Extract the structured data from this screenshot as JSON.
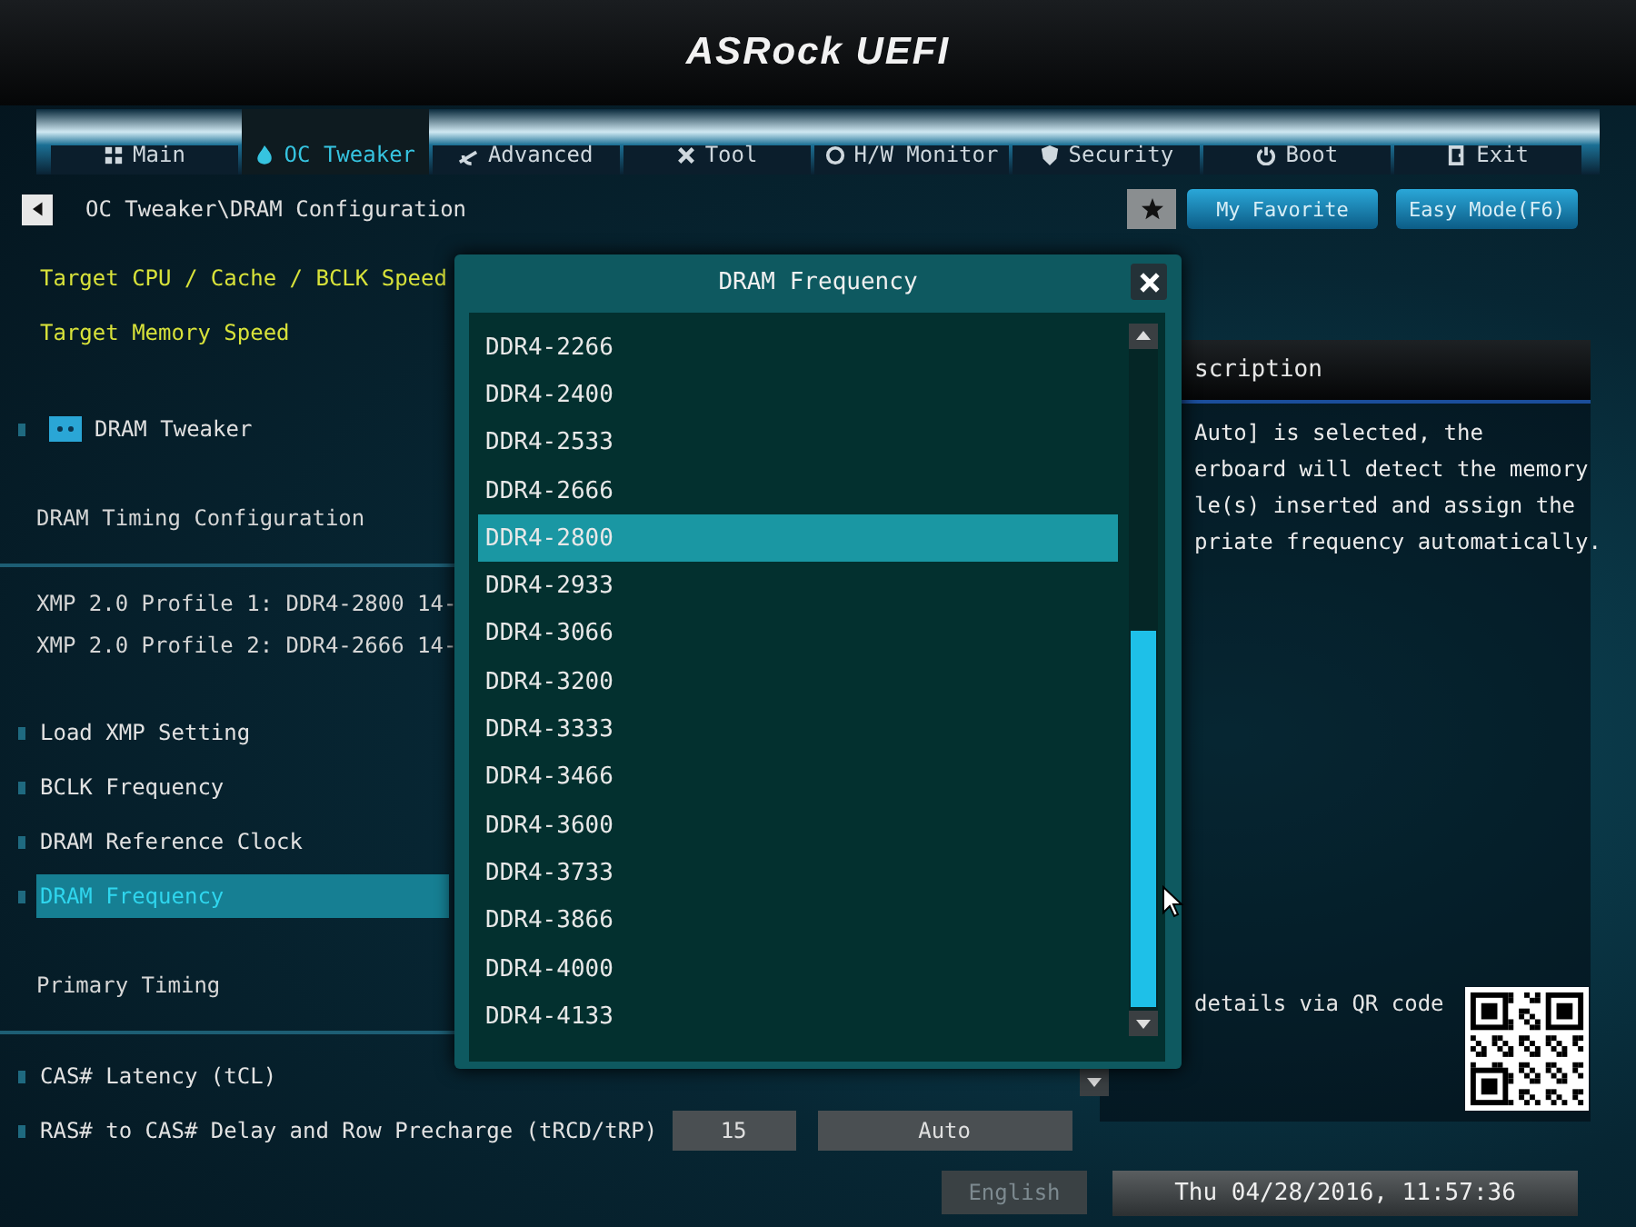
{
  "header": {
    "logo": "ASRock UEFI"
  },
  "tabs": [
    {
      "label": "Main",
      "selected": false
    },
    {
      "label": "OC Tweaker",
      "selected": true
    },
    {
      "label": "Advanced",
      "selected": false
    },
    {
      "label": "Tool",
      "selected": false
    },
    {
      "label": "H/W Monitor",
      "selected": false
    },
    {
      "label": "Security",
      "selected": false
    },
    {
      "label": "Boot",
      "selected": false
    },
    {
      "label": "Exit",
      "selected": false
    }
  ],
  "breadcrumb": {
    "path": "OC Tweaker\\DRAM Configuration"
  },
  "toolbar_buttons": [
    "My Favorite",
    "Easy Mode(F6)"
  ],
  "settings": [
    {
      "kind": "target",
      "label": "Target CPU / Cache / BCLK Speed"
    },
    {
      "kind": "target",
      "label": "Target Memory Speed"
    },
    {
      "kind": "submenu",
      "label": "DRAM Tweaker"
    },
    {
      "kind": "section",
      "label": "DRAM Timing Configuration"
    },
    {
      "kind": "profile",
      "label": "XMP 2.0 Profile 1: DDR4-2800 14-"
    },
    {
      "kind": "profile",
      "label": "XMP 2.0 Profile 2: DDR4-2666 14-"
    },
    {
      "kind": "item",
      "label": "Load XMP Setting",
      "selected": false
    },
    {
      "kind": "item",
      "label": "BCLK Frequency",
      "selected": false
    },
    {
      "kind": "item",
      "label": "DRAM Reference Clock",
      "selected": false
    },
    {
      "kind": "item",
      "label": "DRAM Frequency",
      "selected": true
    },
    {
      "kind": "section",
      "label": "Primary Timing"
    },
    {
      "kind": "item",
      "label": "CAS# Latency (tCL)",
      "selected": false
    },
    {
      "kind": "item",
      "label": "RAS# to CAS# Delay and Row Precharge (tRCD/tRP)",
      "selected": false,
      "values": [
        "15",
        "Auto"
      ]
    }
  ],
  "description": {
    "title": "scription",
    "lines": [
      "Auto] is selected, the",
      "erboard will detect the memory",
      "le(s) inserted and assign the",
      "priate frequency automatically."
    ],
    "qr_caption": "details via QR code"
  },
  "dialog": {
    "title": "DRAM Frequency",
    "options": [
      {
        "label": "DDR4-2266",
        "selected": false
      },
      {
        "label": "DDR4-2400",
        "selected": false
      },
      {
        "label": "DDR4-2533",
        "selected": false
      },
      {
        "label": "DDR4-2666",
        "selected": false
      },
      {
        "label": "DDR4-2800",
        "selected": true
      },
      {
        "label": "DDR4-2933",
        "selected": false
      },
      {
        "label": "DDR4-3066",
        "selected": false
      },
      {
        "label": "DDR4-3200",
        "selected": false
      },
      {
        "label": "DDR4-3333",
        "selected": false
      },
      {
        "label": "DDR4-3466",
        "selected": false
      },
      {
        "label": "DDR4-3600",
        "selected": false
      },
      {
        "label": "DDR4-3733",
        "selected": false
      },
      {
        "label": "DDR4-3866",
        "selected": false
      },
      {
        "label": "DDR4-4000",
        "selected": false
      },
      {
        "label": "DDR4-4133",
        "selected": false
      }
    ]
  },
  "status_bar": {
    "language": "English",
    "datetime": "Thu 04/28/2016, 11:57:36"
  }
}
